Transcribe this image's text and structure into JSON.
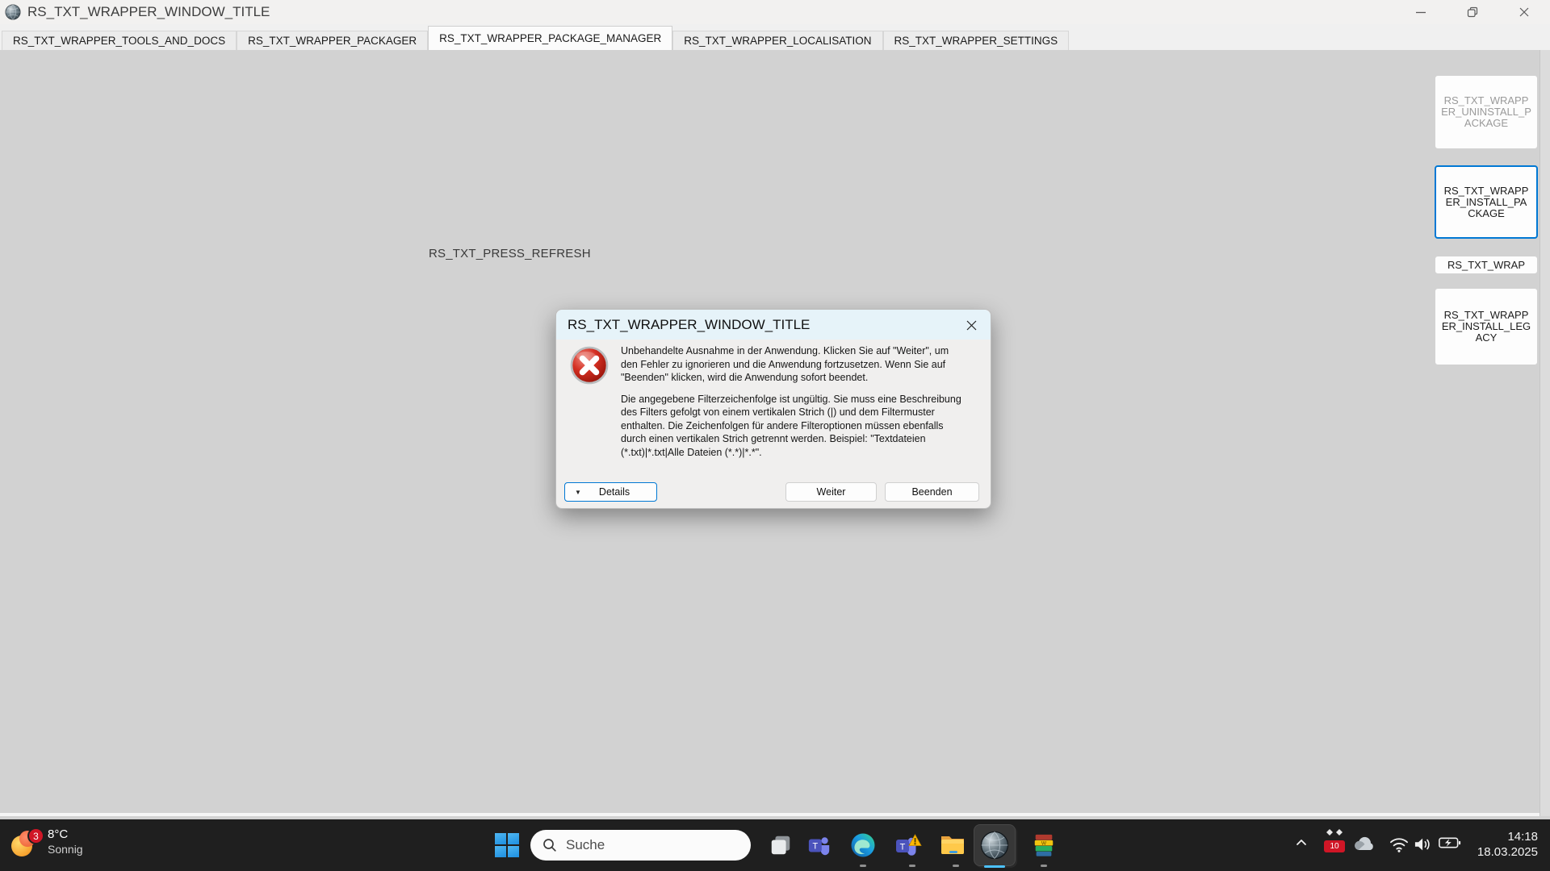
{
  "window": {
    "title": "RS_TXT_WRAPPER_WINDOW_TITLE",
    "icons": {
      "app": "globe-icon",
      "minimize": "minimize-icon",
      "restore": "restore-icon",
      "close": "close-icon"
    }
  },
  "tabs": {
    "active": "RS_TXT_WRAPPER_PACKAGE_MANAGER",
    "items": [
      {
        "label": "RS_TXT_WRAPPER_TOOLS_AND_DOCS"
      },
      {
        "label": "RS_TXT_WRAPPER_PACKAGER"
      },
      {
        "label": "RS_TXT_WRAPPER_PACKAGE_MANAGER"
      },
      {
        "label": "RS_TXT_WRAPPER_LOCALISATION"
      },
      {
        "label": "RS_TXT_WRAPPER_SETTINGS"
      }
    ]
  },
  "content": {
    "placeholder_text": "RS_TXT_PRESS_REFRESH"
  },
  "side_buttons": {
    "items": [
      {
        "label": "RS_TXT_WRAPPER_UNINSTALL_PACKAGE",
        "state": "disabled"
      },
      {
        "label": "RS_TXT_WRAPPER_INSTALL_PACKAGE",
        "state": "focused"
      },
      {
        "label": "RS_TXT_WRAP",
        "state": "normal"
      },
      {
        "label": "RS_TXT_WRAPPER_INSTALL_LEGACY",
        "state": "normal"
      }
    ]
  },
  "dialog": {
    "title": "RS_TXT_WRAPPER_WINDOW_TITLE",
    "message_primary": "Unbehandelte Ausnahme in der Anwendung. Klicken Sie auf \"Weiter\", um den Fehler zu ignorieren und die Anwendung fortzusetzen. Wenn Sie auf \"Beenden\" klicken, wird die Anwendung sofort beendet.",
    "message_secondary": "Die angegebene Filterzeichenfolge ist ungültig. Sie muss eine Beschreibung des Filters gefolgt von einem vertikalen Strich (|) und dem Filtermuster enthalten. Die Zeichenfolgen für andere Filteroptionen müssen ebenfalls durch einen vertikalen Strich getrennt werden. Beispiel: \"Textdateien (*.txt)|*.txt|Alle Dateien (*.*)|*.*\".",
    "buttons": {
      "details": "Details",
      "continue": "Weiter",
      "quit": "Beenden"
    },
    "icons": {
      "severity": "error-icon",
      "details_arrow": "chevron-down-icon",
      "close": "close-icon"
    }
  },
  "taskbar": {
    "weather": {
      "badge": "3",
      "temperature": "8°C",
      "condition": "Sonnig"
    },
    "search": {
      "placeholder": "Suche"
    },
    "pinned_icons": [
      "task-view-icon",
      "teams-icon",
      "edge-icon",
      "teams-warning-icon",
      "file-explorer-icon",
      "app-globe-icon",
      "winrar-icon"
    ],
    "tray": {
      "update_count": "10",
      "time": "14:18",
      "date": "18.03.2025",
      "icons": [
        "tray-chevron-icon",
        "update-badge-icon",
        "onedrive-icon",
        "wifi-icon",
        "volume-icon",
        "battery-icon"
      ]
    }
  },
  "colors": {
    "accent_blue": "#0078d4",
    "taskbar_active_underline": "#4cc2ff",
    "error_red": "#c21807",
    "badge_red": "#d01626",
    "dialog_titlebar": "#e6f3f9",
    "content_background": "#d2d2d2",
    "taskbar_background": "#1f1f1f"
  }
}
